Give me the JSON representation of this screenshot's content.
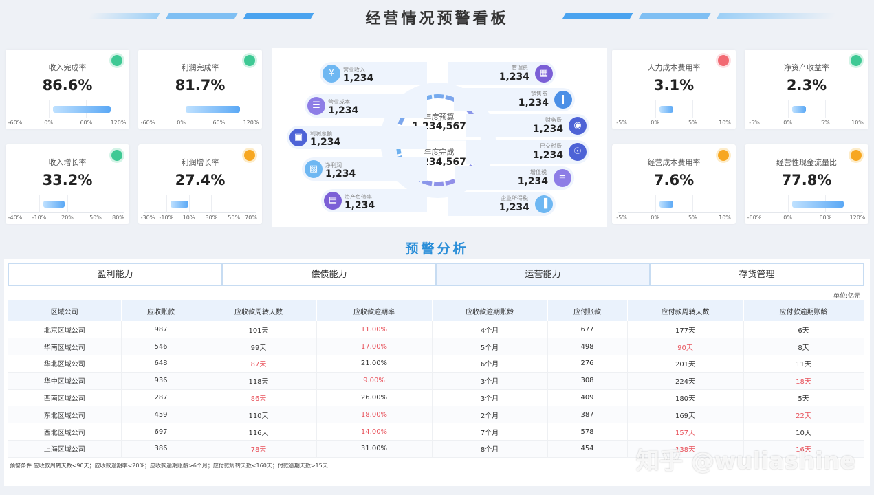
{
  "header": {
    "title": "经营情况预警看板",
    "accent": "#4aa3ef"
  },
  "kpis": [
    {
      "label": "收入完成率",
      "value": "86.6%",
      "status": "green",
      "ticks": [
        "-60%",
        "0%",
        "60%",
        "120%"
      ],
      "bar_range": [
        "0%",
        "120%"
      ],
      "bar_value": 86.6
    },
    {
      "label": "利润完成率",
      "value": "81.7%",
      "status": "green",
      "ticks": [
        "-60%",
        "0%",
        "60%",
        "120%"
      ],
      "bar_range": [
        "0%",
        "120%"
      ],
      "bar_value": 81.7
    },
    {
      "label": "收入增长率",
      "value": "33.2%",
      "status": "green",
      "ticks": [
        "-40%",
        "-10%",
        "20%",
        "50%",
        "80%"
      ],
      "bar_range": [
        "-10%",
        "80%"
      ],
      "bar_value": 33.2
    },
    {
      "label": "利润增长率",
      "value": "27.4%",
      "status": "orange",
      "ticks": [
        "-30%",
        "-10%",
        "10%",
        "30%",
        "50%",
        "70%"
      ],
      "bar_range": [
        "-10%",
        "70%"
      ],
      "bar_value": 27.4
    },
    {
      "label": "人力成本费用率",
      "value": "3.1%",
      "status": "red",
      "ticks": [
        "-5%",
        "0%",
        "5%",
        "10%"
      ],
      "bar_range": [
        "0%",
        "10%"
      ],
      "bar_value": 3.1
    },
    {
      "label": "净资产收益率",
      "value": "2.3%",
      "status": "green",
      "ticks": [
        "-5%",
        "0%",
        "5%",
        "10%"
      ],
      "bar_range": [
        "0%",
        "10%"
      ],
      "bar_value": 2.3
    },
    {
      "label": "经营成本费用率",
      "value": "7.6%",
      "status": "orange",
      "ticks": [
        "-5%",
        "0%",
        "5%",
        "10%"
      ],
      "bar_range": [
        "0%",
        "10%"
      ],
      "bar_value": 7.6
    },
    {
      "label": "经营性现金流量比",
      "value": "77.8%",
      "status": "orange",
      "ticks": [
        "-60%",
        "0%",
        "60%",
        "120%"
      ],
      "bar_range": [
        "0%",
        "120%"
      ],
      "bar_value": 77.8
    }
  ],
  "center": {
    "budget_label": "年度预算",
    "budget_value": "1,234,567",
    "done_label": "年度完成",
    "done_value": "1,234,567",
    "left_items": [
      {
        "label": "营业收入",
        "value": "1,234",
        "icon": "money-bag-icon",
        "color": "#6eb7f2"
      },
      {
        "label": "营业成本",
        "value": "1,234",
        "icon": "receipt-icon",
        "color": "#8d7de6"
      },
      {
        "label": "利润总额",
        "value": "1,234",
        "icon": "wallet-icon",
        "color": "#4e63d6"
      },
      {
        "label": "净利润",
        "value": "1,234",
        "icon": "chart-image-icon",
        "color": "#6eb7f2"
      },
      {
        "label": "资产负债率",
        "value": "1,234",
        "icon": "document-chart-icon",
        "color": "#7b5fd6"
      }
    ],
    "right_items": [
      {
        "label": "管理费",
        "value": "1,234",
        "icon": "calendar-icon",
        "color": "#7b5fd6"
      },
      {
        "label": "销售费",
        "value": "1,234",
        "icon": "bar-chart-icon",
        "color": "#4b8fe6"
      },
      {
        "label": "财务费",
        "value": "1,234",
        "icon": "safe-icon",
        "color": "#4e63d6"
      },
      {
        "label": "已交税费",
        "value": "1,234",
        "icon": "search-coin-icon",
        "color": "#4e63d6"
      },
      {
        "label": "增值税",
        "value": "1,234",
        "icon": "coins-icon",
        "color": "#8d7de6"
      },
      {
        "label": "企业所得税",
        "value": "1,234",
        "icon": "building-chart-icon",
        "color": "#6eb7f2"
      }
    ]
  },
  "analysis": {
    "title": "预警分析",
    "tabs": [
      "盈利能力",
      "偿债能力",
      "运营能力",
      "存货管理"
    ],
    "active_tab": 2,
    "unit": "单位:亿元",
    "columns": [
      "区域公司",
      "应收账款",
      "应收款周转天数",
      "应收款逾期率",
      "应收款逾期账龄",
      "应付账款",
      "应付款周转天数",
      "应付款逾期账龄"
    ],
    "rows": [
      {
        "cells": [
          "北京区域公司",
          "987",
          "101天",
          "11.00%",
          "4个月",
          "677",
          "177天",
          "6天"
        ],
        "warn": [
          3
        ]
      },
      {
        "cells": [
          "华南区域公司",
          "546",
          "99天",
          "17.00%",
          "5个月",
          "498",
          "90天",
          "8天"
        ],
        "warn": [
          3,
          6
        ]
      },
      {
        "cells": [
          "华北区域公司",
          "648",
          "87天",
          "21.00%",
          "6个月",
          "276",
          "201天",
          "11天"
        ],
        "warn": [
          2
        ]
      },
      {
        "cells": [
          "华中区域公司",
          "936",
          "118天",
          "9.00%",
          "3个月",
          "308",
          "224天",
          "18天"
        ],
        "warn": [
          3,
          7
        ]
      },
      {
        "cells": [
          "西南区域公司",
          "287",
          "86天",
          "26.00%",
          "3个月",
          "409",
          "180天",
          "5天"
        ],
        "warn": [
          2
        ]
      },
      {
        "cells": [
          "东北区域公司",
          "459",
          "110天",
          "18.00%",
          "2个月",
          "387",
          "169天",
          "22天"
        ],
        "warn": [
          3,
          7
        ]
      },
      {
        "cells": [
          "西北区域公司",
          "697",
          "116天",
          "14.00%",
          "7个月",
          "578",
          "157天",
          "10天"
        ],
        "warn": [
          3,
          6
        ]
      },
      {
        "cells": [
          "上海区域公司",
          "386",
          "78天",
          "31.00%",
          "8个月",
          "454",
          "138天",
          "16天"
        ],
        "warn": [
          2,
          6,
          7
        ]
      }
    ],
    "note": "预警条件:应收款周转天数<90天；应收款逾期率<20%；应收款逾期账龄>6个月；应付款周转天数<160天；付款逾期天数>15天"
  },
  "watermark": "知乎 @wuliashine"
}
